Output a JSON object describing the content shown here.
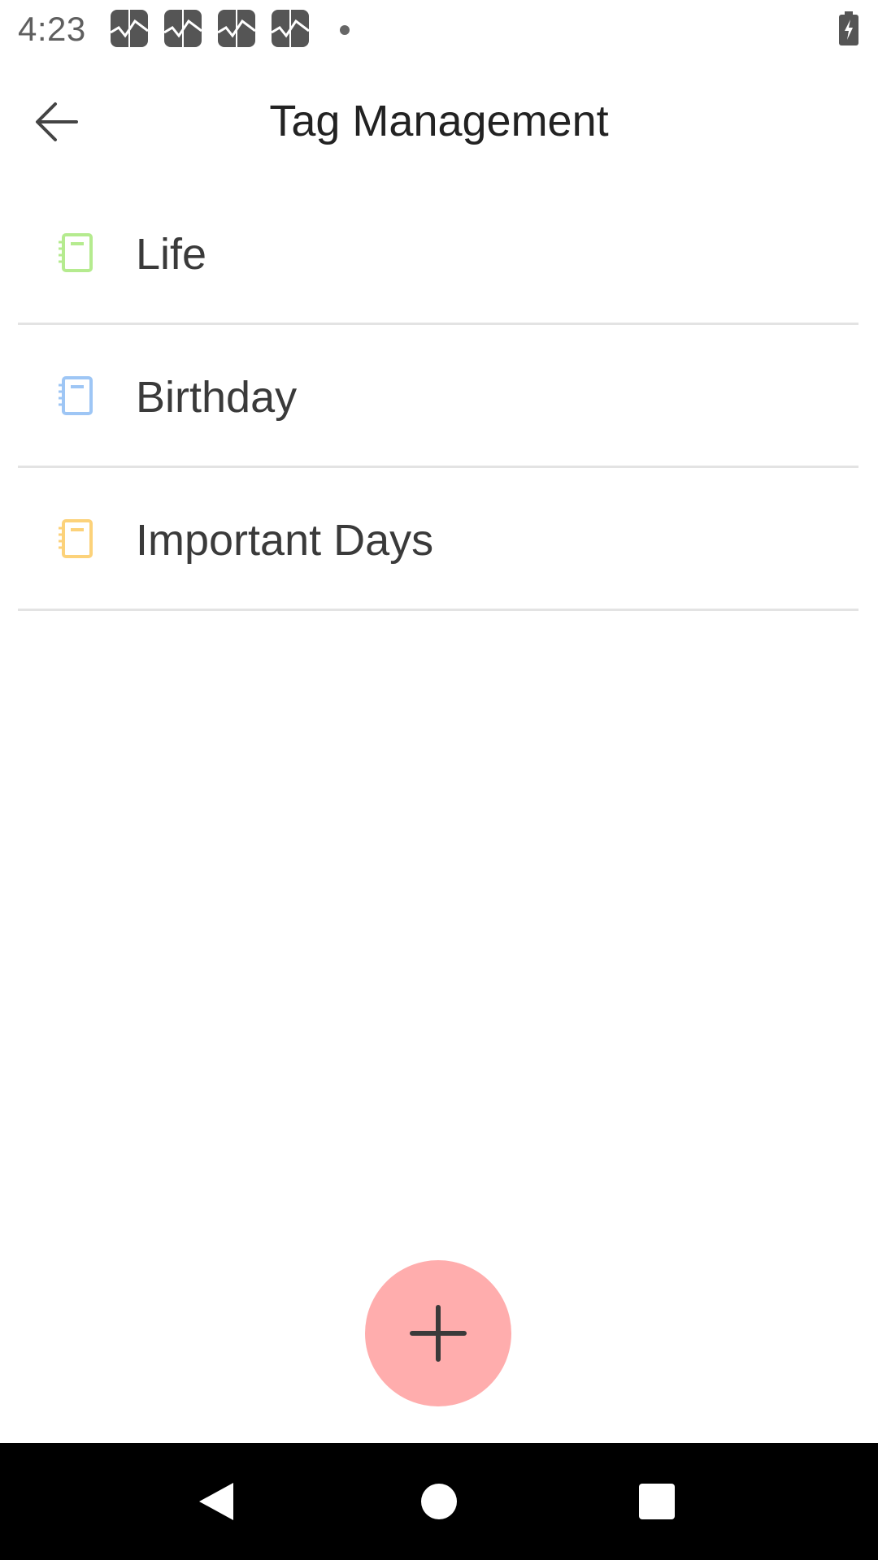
{
  "status_bar": {
    "time": "4:23",
    "notification_icons": [
      "sina-weibo-icon",
      "sina-weibo-icon",
      "sina-weibo-icon",
      "sina-weibo-icon"
    ],
    "battery_state": "charging"
  },
  "app_bar": {
    "title": "Tag Management",
    "back_icon": "arrow-left-icon"
  },
  "tags": [
    {
      "label": "Life",
      "icon": "notebook-icon",
      "color": "#b5eb8f"
    },
    {
      "label": "Birthday",
      "icon": "notebook-icon",
      "color": "#9ec6f5"
    },
    {
      "label": "Important Days",
      "icon": "notebook-icon",
      "color": "#fcd27a"
    }
  ],
  "fab": {
    "icon": "plus-icon",
    "color": "#ffadad"
  },
  "nav_bar": {
    "buttons": [
      "back-triangle-icon",
      "home-circle-icon",
      "recents-square-icon"
    ]
  }
}
